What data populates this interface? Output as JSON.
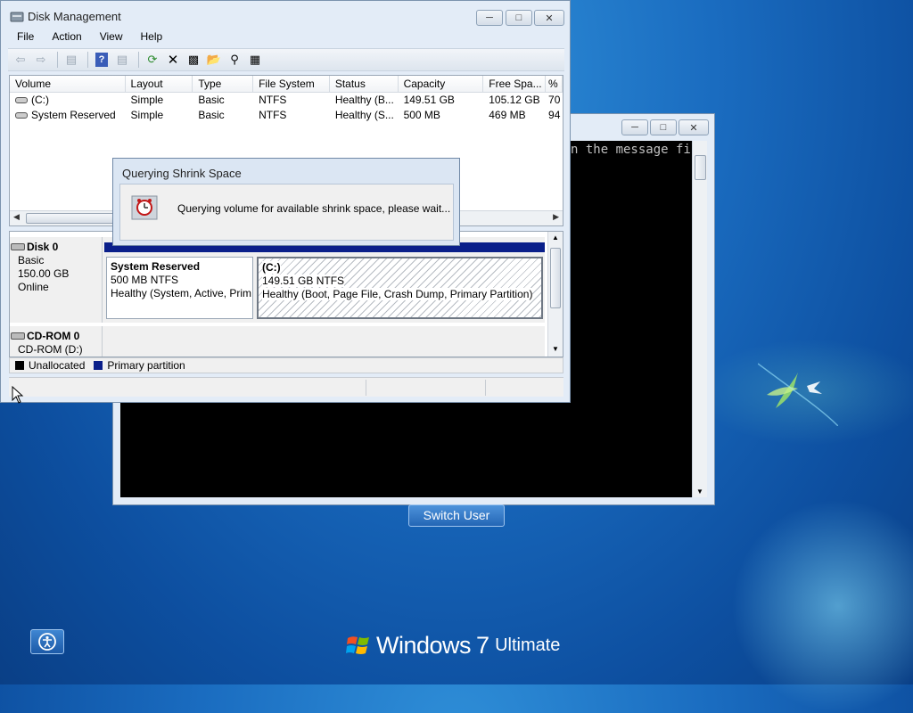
{
  "desktop": {
    "switch_user_label": "Switch User",
    "branding": {
      "windows": "Windows",
      "version": "7",
      "edition": "Ultimate"
    },
    "icons": [
      "ease-of-access-icon",
      "windows-flag-logo"
    ]
  },
  "cmd_window": {
    "visible_text": "n the message fil"
  },
  "disk_mgmt": {
    "title": "Disk Management",
    "menu": [
      "File",
      "Action",
      "View",
      "Help"
    ],
    "toolbar_icons": [
      "back-icon",
      "forward-icon",
      "show-pane-icon",
      "help-icon",
      "properties-icon",
      "refresh-icon",
      "delete-icon",
      "connect-disk-icon",
      "open-icon",
      "explore-icon",
      "rescan-icon"
    ],
    "columns": [
      "Volume",
      "Layout",
      "Type",
      "File System",
      "Status",
      "Capacity",
      "Free Spa...",
      "% F"
    ],
    "volumes": [
      {
        "name": "(C:)",
        "layout": "Simple",
        "type": "Basic",
        "fs": "NTFS",
        "status": "Healthy (B...",
        "capacity": "149.51 GB",
        "free": "105.12 GB",
        "pct": "70"
      },
      {
        "name": "System Reserved",
        "layout": "Simple",
        "type": "Basic",
        "fs": "NTFS",
        "status": "Healthy (S...",
        "capacity": "500 MB",
        "free": "469 MB",
        "pct": "94"
      }
    ],
    "disks": [
      {
        "name": "Disk 0",
        "type": "Basic",
        "size": "150.00 GB",
        "state": "Online",
        "partitions": [
          {
            "title": "System Reserved",
            "size_fs": "500 MB NTFS",
            "status": "Healthy (System, Active, Prim"
          },
          {
            "title": "(C:)",
            "size_fs": "149.51 GB NTFS",
            "status": "Healthy (Boot, Page File, Crash Dump, Primary Partition)"
          }
        ]
      },
      {
        "name": "CD-ROM 0",
        "type": "CD-ROM (D:)"
      }
    ],
    "legend": [
      {
        "label": "Unallocated",
        "color": "#000000"
      },
      {
        "label": "Primary partition",
        "color": "#0a1f8a"
      }
    ]
  },
  "dialog": {
    "title": "Querying Shrink Space",
    "message": "Querying volume for available shrink space, please wait..."
  }
}
